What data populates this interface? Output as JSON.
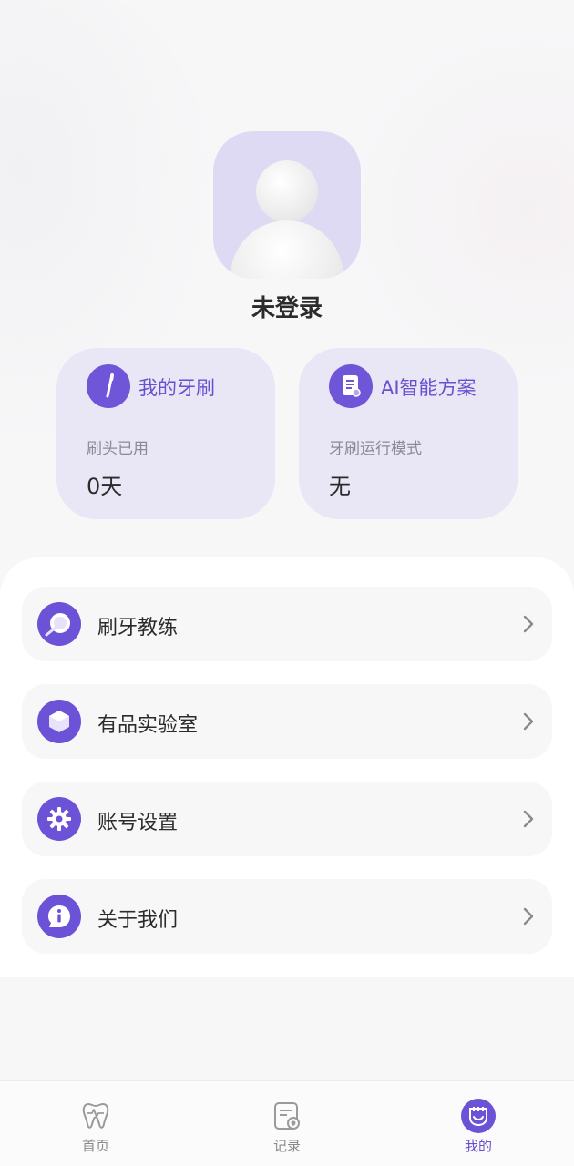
{
  "profile": {
    "username": "未登录"
  },
  "cards": [
    {
      "title": "我的牙刷",
      "subtitle": "刷头已用",
      "value": "0天",
      "icon": "toothbrush-icon"
    },
    {
      "title": "AI智能方案",
      "subtitle": "牙刷运行模式",
      "value": "无",
      "icon": "document-icon"
    }
  ],
  "menu": [
    {
      "label": "刷牙教练",
      "icon": "coach-icon"
    },
    {
      "label": "有品实验室",
      "icon": "cube-icon"
    },
    {
      "label": "账号设置",
      "icon": "gear-icon"
    },
    {
      "label": "关于我们",
      "icon": "info-icon"
    }
  ],
  "tabbar": [
    {
      "label": "首页",
      "icon": "tooth-icon",
      "active": false
    },
    {
      "label": "记录",
      "icon": "record-icon",
      "active": false
    },
    {
      "label": "我的",
      "icon": "profile-smile-icon",
      "active": true
    }
  ],
  "colors": {
    "accent": "#6c52d6",
    "card_bg": "#e9e6f6",
    "avatar_bg": "#dedaf3"
  }
}
